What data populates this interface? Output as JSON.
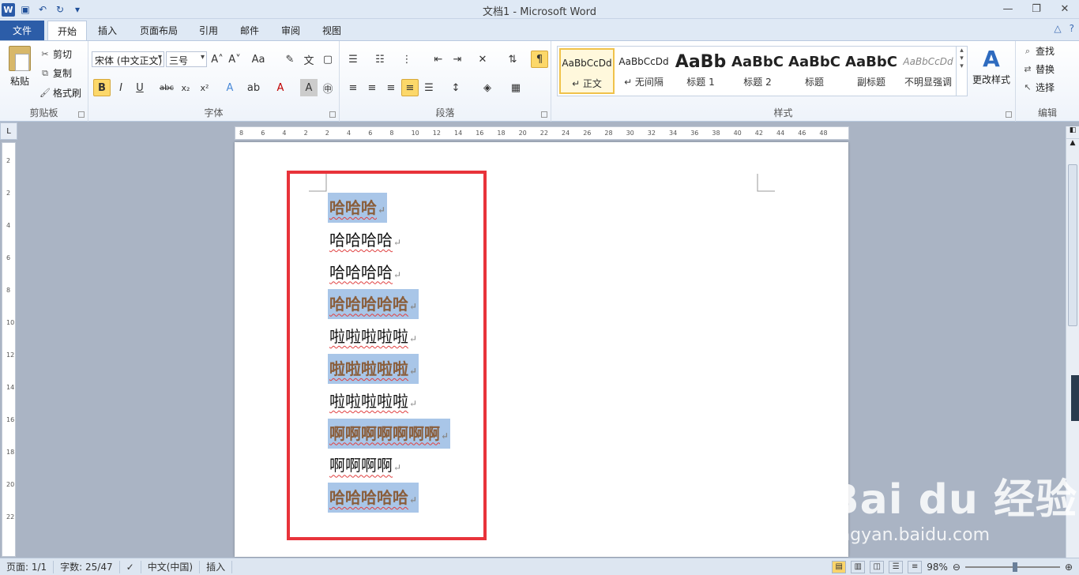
{
  "titlebar": {
    "title": "文档1 - Microsoft Word",
    "app_icon_letter": "W",
    "qat": [
      "save-icon",
      "undo-icon",
      "redo-icon",
      "customize-qat-icon"
    ]
  },
  "tabs": {
    "file": "文件",
    "items": [
      "开始",
      "插入",
      "页面布局",
      "引用",
      "邮件",
      "审阅",
      "视图"
    ],
    "active": "开始"
  },
  "ribbon": {
    "clipboard": {
      "label": "剪贴板",
      "paste": "粘贴",
      "cut": "剪切",
      "copy": "复制",
      "format_painter": "格式刷"
    },
    "font": {
      "label": "字体",
      "name": "宋体 (中文正文)",
      "size": "三号",
      "case_label": "Aa",
      "font_color": "#c00000",
      "highlight_color": "#ffff00"
    },
    "paragraph": {
      "label": "段落"
    },
    "styles": {
      "label": "样式",
      "change_styles": "更改样式",
      "tiles": [
        {
          "sample": "AaBbCcDd",
          "name": "↵ 正文"
        },
        {
          "sample": "AaBbCcDd",
          "name": "↵ 无间隔"
        },
        {
          "sample": "AaBb",
          "name": "标题 1"
        },
        {
          "sample": "AaBbC",
          "name": "标题 2"
        },
        {
          "sample": "AaBbC",
          "name": "标题"
        },
        {
          "sample": "AaBbC",
          "name": "副标题"
        },
        {
          "sample": "AaBbCcDd",
          "name": "不明显强调"
        }
      ]
    },
    "editing": {
      "label": "编辑",
      "find": "查找",
      "replace": "替换",
      "select": "选择"
    }
  },
  "document": {
    "lines": [
      {
        "text": "哈哈哈",
        "highlighted": true
      },
      {
        "text": "哈哈哈哈",
        "highlighted": false
      },
      {
        "text": "哈哈哈哈",
        "highlighted": false
      },
      {
        "text": "哈哈哈哈哈",
        "highlighted": true
      },
      {
        "text": "啦啦啦啦啦",
        "highlighted": false
      },
      {
        "text": "啦啦啦啦啦",
        "highlighted": true
      },
      {
        "text": "啦啦啦啦啦",
        "highlighted": false
      },
      {
        "text": "啊啊啊啊啊啊啊",
        "highlighted": true
      },
      {
        "text": "啊啊啊啊",
        "highlighted": false
      },
      {
        "text": "哈哈哈哈哈",
        "highlighted": true
      }
    ],
    "paragraph_mark": "↵",
    "selection_color": "#a9c6e8",
    "annotation_color": "#e8333a"
  },
  "hruler_ticks": [
    "8",
    "6",
    "4",
    "2",
    "2",
    "4",
    "6",
    "8",
    "10",
    "12",
    "14",
    "16",
    "18",
    "20",
    "22",
    "24",
    "26",
    "28",
    "30",
    "32",
    "34",
    "36",
    "38",
    "40",
    "42",
    "44",
    "46",
    "48"
  ],
  "vruler_ticks": [
    "2",
    "2",
    "4",
    "6",
    "8",
    "10",
    "12",
    "14",
    "16",
    "18",
    "20",
    "22"
  ],
  "status": {
    "page": "页面: 1/1",
    "words": "字数: 25/47",
    "language": "中文(中国)",
    "mode": "插入",
    "zoom": "98%"
  },
  "watermark": {
    "brand": "Bai du 经验",
    "url": "jingyan.baidu.com"
  }
}
